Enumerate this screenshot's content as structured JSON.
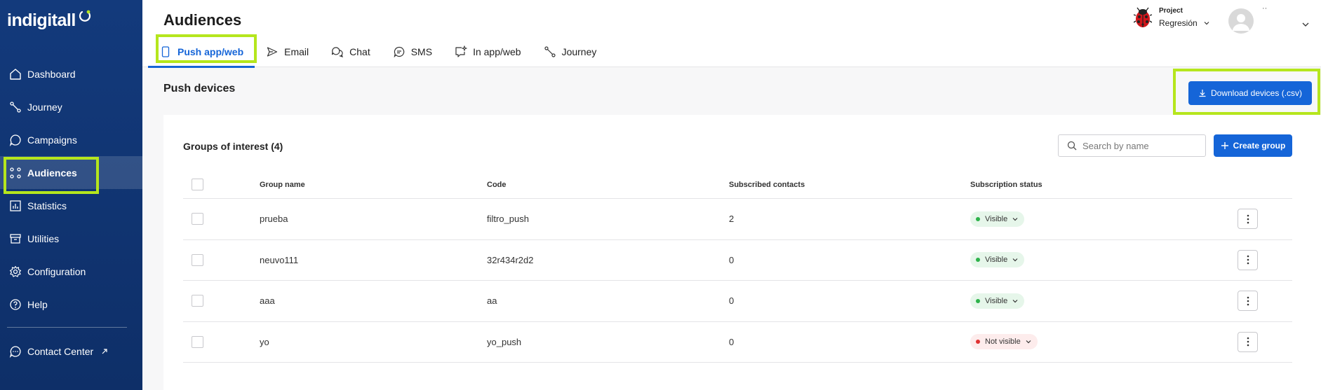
{
  "app": {
    "logo_text": "indigitall"
  },
  "sidebar": {
    "items": [
      {
        "label": "Dashboard",
        "icon": "home-icon"
      },
      {
        "label": "Journey",
        "icon": "journey-icon"
      },
      {
        "label": "Campaigns",
        "icon": "chat-bubble-icon"
      },
      {
        "label": "Audiences",
        "icon": "audiences-icon",
        "active": true
      },
      {
        "label": "Statistics",
        "icon": "chart-icon"
      },
      {
        "label": "Utilities",
        "icon": "box-icon"
      },
      {
        "label": "Configuration",
        "icon": "gear-icon"
      },
      {
        "label": "Help",
        "icon": "help-icon"
      }
    ],
    "contact_center": {
      "label": "Contact Center",
      "icon": "external-link-icon"
    }
  },
  "header": {
    "title": "Audiences",
    "tabs": [
      {
        "label": "Push app/web",
        "icon": "mobile-icon",
        "active": true
      },
      {
        "label": "Email",
        "icon": "send-icon"
      },
      {
        "label": "Chat",
        "icon": "chat-icon"
      },
      {
        "label": "SMS",
        "icon": "sms-icon"
      },
      {
        "label": "In app/web",
        "icon": "inapp-icon"
      },
      {
        "label": "Journey",
        "icon": "journey-icon"
      }
    ],
    "project": {
      "label": "Project",
      "name": "Regresión",
      "icon": "ladybug-icon"
    },
    "user": {
      "name": "··"
    }
  },
  "main": {
    "section_title": "Push devices",
    "download_label": "Download devices (.csv)",
    "groups": {
      "title": "Groups of interest (4)",
      "search_placeholder": "Search by name",
      "create_label": "Create group",
      "columns": [
        "Group name",
        "Code",
        "Subscribed contacts",
        "Subscription status"
      ],
      "rows": [
        {
          "name": "prueba",
          "code": "filtro_push",
          "subscribed": "2",
          "status": "Visible",
          "visible": true
        },
        {
          "name": "neuvo111",
          "code": "32r434r2d2",
          "subscribed": "0",
          "status": "Visible",
          "visible": true
        },
        {
          "name": "aaa",
          "code": "aa",
          "subscribed": "0",
          "status": "Visible",
          "visible": true
        },
        {
          "name": "yo",
          "code": "yo_push",
          "subscribed": "0",
          "status": "Not visible",
          "visible": false
        }
      ]
    }
  },
  "colors": {
    "sidebar": "#133a7c",
    "accent": "#1565d8",
    "highlight": "#b5e61d",
    "visible": "#2db24a",
    "not_visible": "#e03131"
  }
}
